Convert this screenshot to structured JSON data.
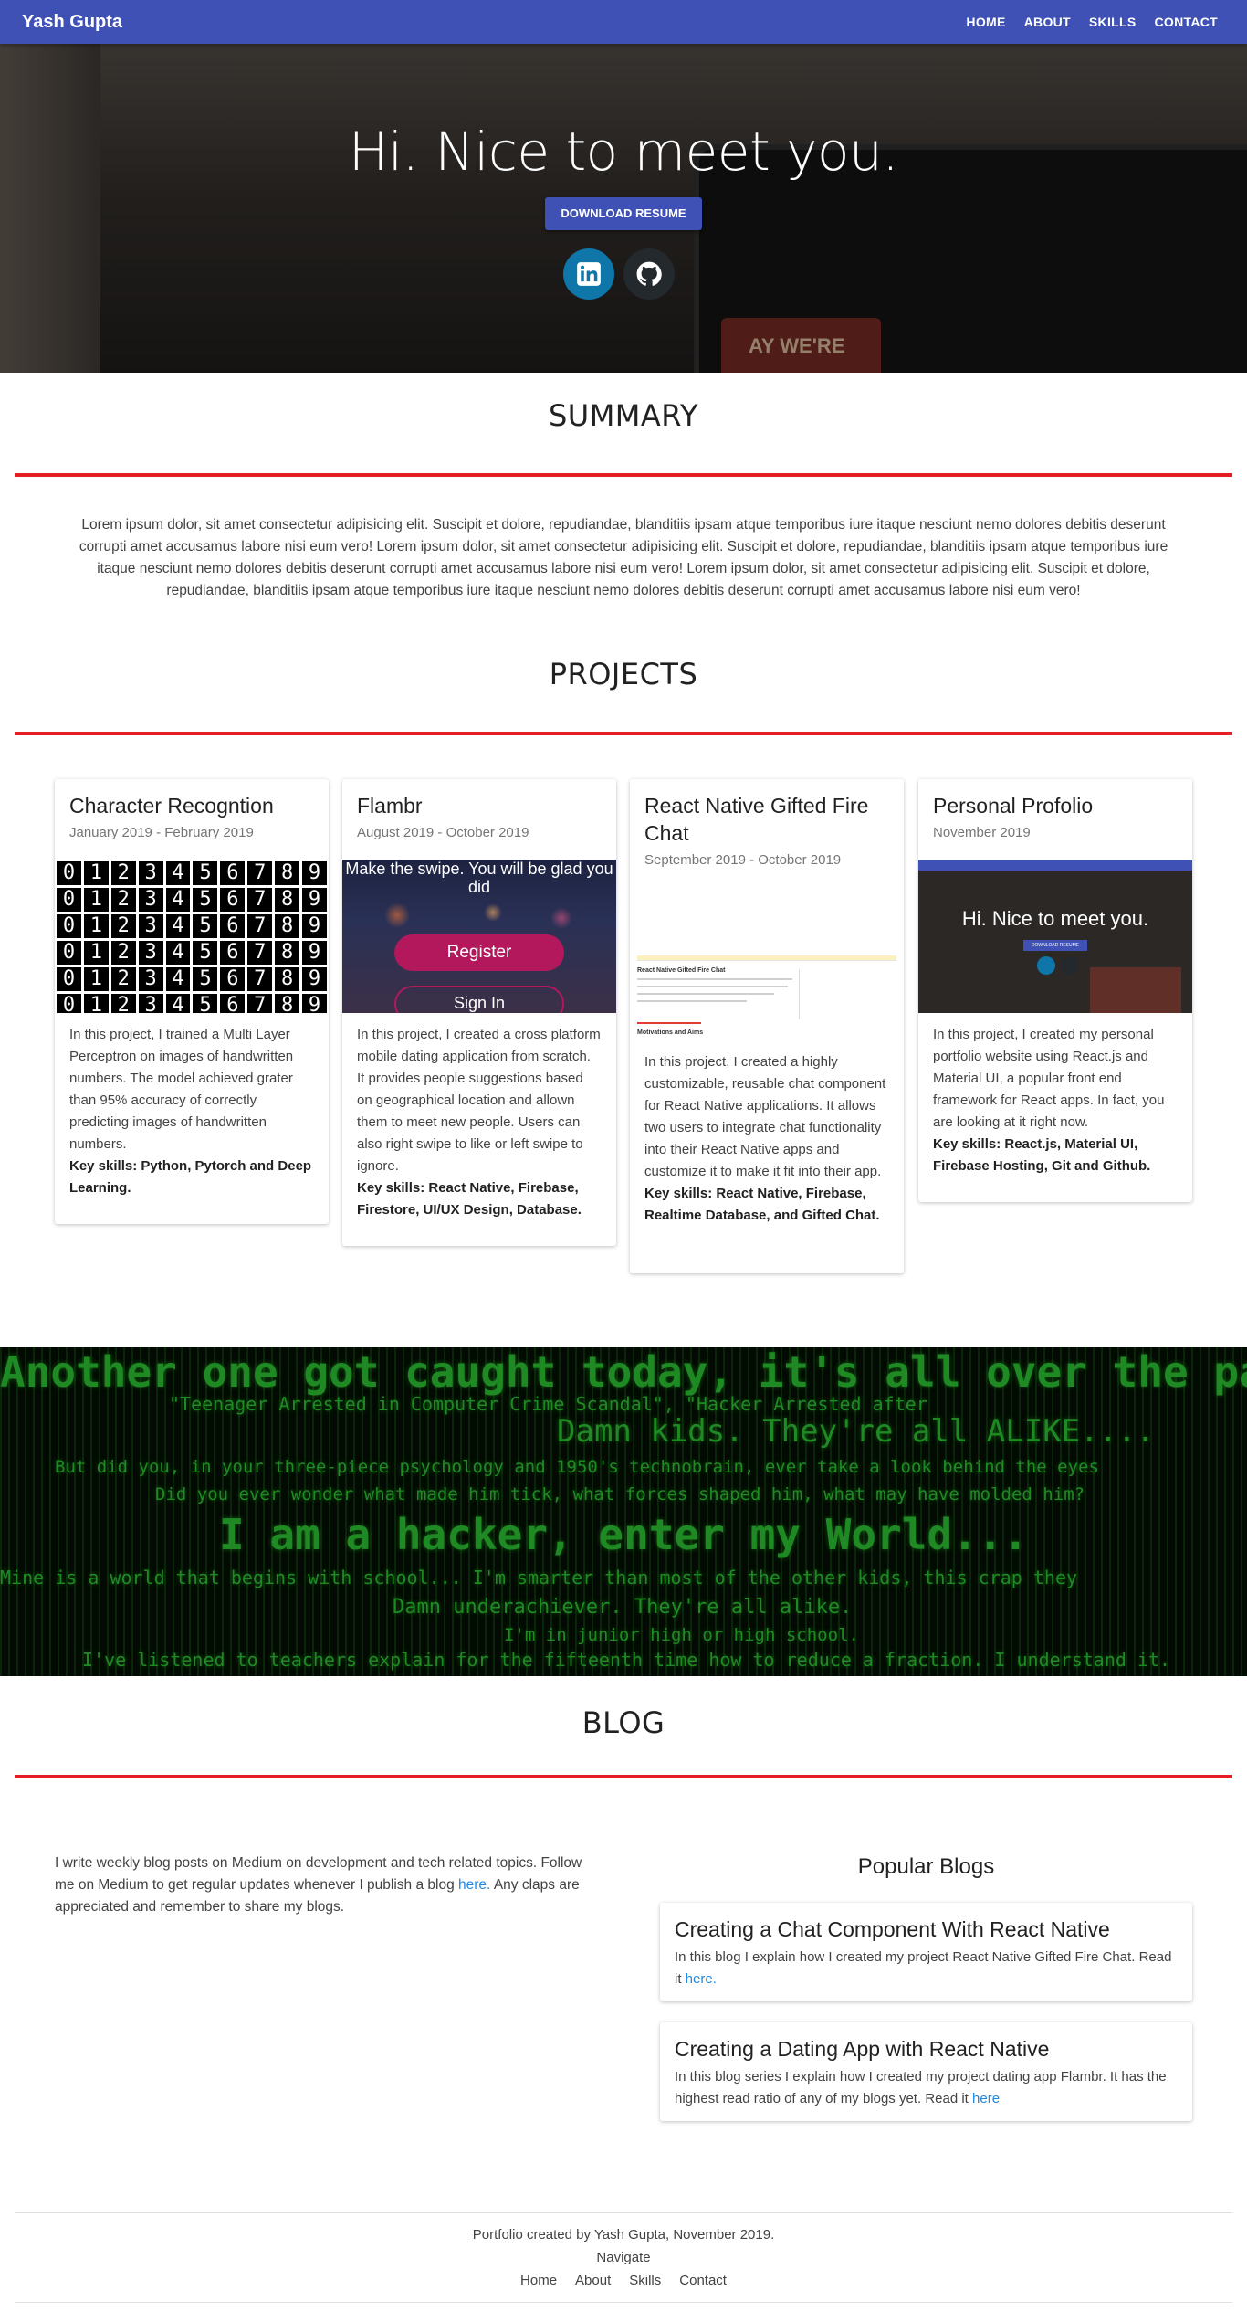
{
  "navbar": {
    "brand": "Yash Gupta",
    "links": [
      "HOME",
      "ABOUT",
      "SKILLS",
      "CONTACT"
    ]
  },
  "hero": {
    "title": "Hi. Nice to meet you.",
    "resume_button": "DOWNLOAD RESUME",
    "sign_text": "AY WE'RE",
    "social": [
      "linkedin-icon",
      "github-icon"
    ]
  },
  "summary": {
    "title": "SUMMARY",
    "text": "Lorem ipsum dolor, sit amet consectetur adipisicing elit. Suscipit et dolore, repudiandae, blanditiis ipsam atque temporibus iure itaque nesciunt nemo dolores debitis deserunt corrupti amet accusamus labore nisi eum vero! Lorem ipsum dolor, sit amet consectetur adipisicing elit. Suscipit et dolore, repudiandae, blanditiis ipsam atque temporibus iure itaque nesciunt nemo dolores debitis deserunt corrupti amet accusamus labore nisi eum vero! Lorem ipsum dolor, sit amet consectetur adipisicing elit. Suscipit et dolore, repudiandae, blanditiis ipsam atque temporibus iure itaque nesciunt nemo dolores debitis deserunt corrupti amet accusamus labore nisi eum vero!"
  },
  "projects": {
    "title": "PROJECTS",
    "items": [
      {
        "title": "Character Recogntion",
        "date": "January 2019 - February 2019",
        "description": "In this project, I trained a Multi Layer Perceptron on images of handwritten numbers. The model achieved grater than 95% accuracy of correctly predicting images of handwritten numbers.",
        "skills": "Key skills: Python, Pytorch and Deep Learning."
      },
      {
        "title": "Flambr",
        "date": "August 2019 - October 2019",
        "description": "In this project, I created a cross platform mobile dating application from scratch. It provides people suggestions based on geographical location and allown them to meet new people. Users can also right swipe to like or left swipe to ignore.",
        "skills": "Key skills: React Native, Firebase, Firestore, UI/UX Design, Database.",
        "image_text": {
          "tagline": "Make the swipe. You will be glad you did",
          "register": "Register",
          "sign_in": "Sign In"
        }
      },
      {
        "title": "React Native Gifted Fire Chat",
        "date": "September 2019 - October 2019",
        "description": "In this project, I created a highly customizable, reusable chat component for React Native applications. It allows two users to integrate chat functionality into their React Native apps and customize it to make it fit into their app.",
        "skills": "Key skills: React Native, Firebase, Realtime Database, and Gifted Chat.",
        "image_text": {
          "heading": "React Native Gifted Fire Chat",
          "subheading": "Motivations and Aims"
        }
      },
      {
        "title": "Personal Profolio",
        "date": "November 2019",
        "description": "In this project, I created my personal portfolio website using React.js and Material UI, a popular front end framework for React apps. In fact, you are looking at it right now.",
        "skills": "Key skills: React.js, Material UI, Firebase Hosting, Git and Github.",
        "image_text": {
          "title": "Hi. Nice to meet you.",
          "button": "DOWNLOAD RESUME"
        }
      }
    ],
    "mnist_digits": [
      "0",
      "1",
      "2",
      "3",
      "4",
      "5",
      "6",
      "7",
      "8",
      "9"
    ]
  },
  "hacker_banner": {
    "lines": [
      "Another one got caught today, it's all over the papers.",
      "\"Teenager Arrested in Computer Crime Scandal\",    \"Hacker Arrested after",
      "Damn kids. They're all ALIKE....",
      "But did you, in your three-piece psychology and 1950's technobrain, ever take a look behind the eyes",
      "Did you ever wonder what made him tick, what forces shaped him, what may have molded him?",
      "I am a hacker, enter my World...",
      "Mine is a world that begins with school... I'm smarter than most of the other kids, this crap they",
      "Damn underachiever. They're all alike.",
      "I'm in junior high or high school.",
      "I've listened to teachers explain for the fifteenth time how to reduce a fraction. I understand it."
    ]
  },
  "blog": {
    "title": "BLOG",
    "intro": "I write weekly blog posts on Medium on development and tech related topics. Follow me on Medium to get regular updates whenever I publish a blog",
    "intro_link": "here.",
    "intro_tail": "Any claps are appreciated and remember to share my blogs.",
    "popular_title": "Popular Blogs",
    "posts": [
      {
        "title": "Creating a Chat Component With React Native",
        "body": "In this blog I explain how I created my project React Native Gifted Fire Chat. Read it",
        "link": "here."
      },
      {
        "title": "Creating a Dating App with React Native",
        "body": "In this blog series I explain how I created my project dating app Flambr. It has the highest read ratio of any of my blogs yet. Read it",
        "link": "here"
      }
    ]
  },
  "footer": {
    "credit": "Portfolio created by Yash Gupta, November 2019.",
    "navigate": "Navigate",
    "links": [
      "Home",
      "About",
      "Skills",
      "Contact"
    ]
  },
  "colors": {
    "primary": "#3f51b5",
    "accent_rule": "#e41e24",
    "link": "#1e88e5",
    "linkedin": "#0e76a8",
    "github": "#24292e",
    "hacker_green": "#1f8a24"
  }
}
